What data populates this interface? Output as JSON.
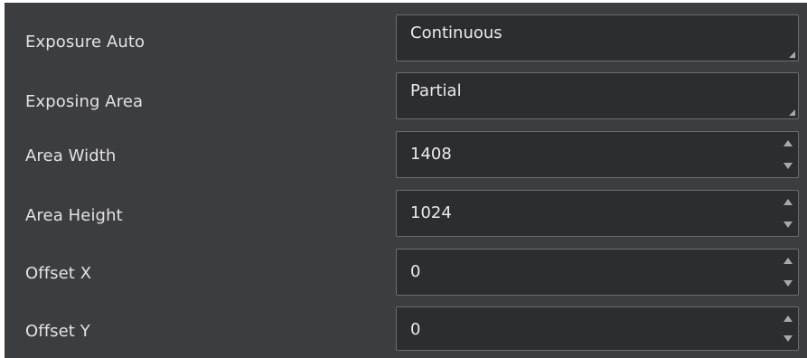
{
  "properties": [
    {
      "label": "Exposure Auto",
      "value": "Continuous",
      "control": "dropdown",
      "icon": "resize-grip-icon"
    },
    {
      "label": "Exposing Area",
      "value": "Partial",
      "control": "dropdown",
      "icon": "resize-grip-icon"
    },
    {
      "label": "Area Width",
      "value": "1408",
      "control": "spinbox"
    },
    {
      "label": "Area Height",
      "value": "1024",
      "control": "spinbox"
    },
    {
      "label": "Offset X",
      "value": "0",
      "control": "spinbox"
    },
    {
      "label": "Offset Y",
      "value": "0",
      "control": "spinbox"
    }
  ],
  "colors": {
    "panel_background": "#3c3d3f",
    "field_background": "#2c2d2f",
    "field_border": "#6b6c6e",
    "text": "#e3e3e3",
    "arrow": "#a8a9ab"
  },
  "icons": {
    "spin_up": "triangle-up-icon",
    "spin_down": "triangle-down-icon"
  }
}
